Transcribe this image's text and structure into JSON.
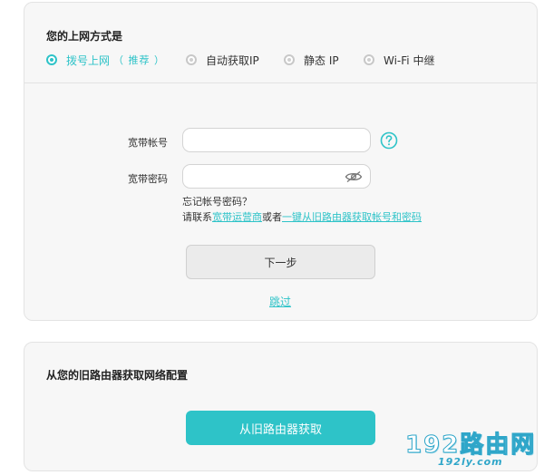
{
  "colors": {
    "accent": "#2ec3c8",
    "card_background": "#f7f7f7",
    "card_border": "#e3e3e3",
    "watermark": "#2fa6c9"
  },
  "connection_mode": {
    "title": "您的上网方式是",
    "options": [
      {
        "label": "拨号上网",
        "hint": "（ 推荐 ）",
        "selected": true
      },
      {
        "label": "自动获取IP",
        "selected": false
      },
      {
        "label": "静态 IP",
        "selected": false
      },
      {
        "label": "Wi-Fi 中继",
        "selected": false
      }
    ]
  },
  "pppoe_form": {
    "account_label": "宽带帐号",
    "account_value": "",
    "password_label": "宽带密码",
    "password_value": "",
    "help_icon": "question-circle-icon",
    "eye_icon": "eye-icon",
    "forgot_text": "忘记帐号密码？",
    "contact_prefix": "请联系",
    "isp_link": "宽带运营商",
    "contact_middle": "或者",
    "old_router_link": "一键从旧路由器获取帐号和密码",
    "next_button": "下一步",
    "skip_link": "跳过"
  },
  "old_router": {
    "title": "从您的旧路由器获取网络配置",
    "fetch_button": "从旧路由器获取"
  },
  "watermark": {
    "logo_text": "192路由网",
    "url_text": "192ly.com"
  }
}
